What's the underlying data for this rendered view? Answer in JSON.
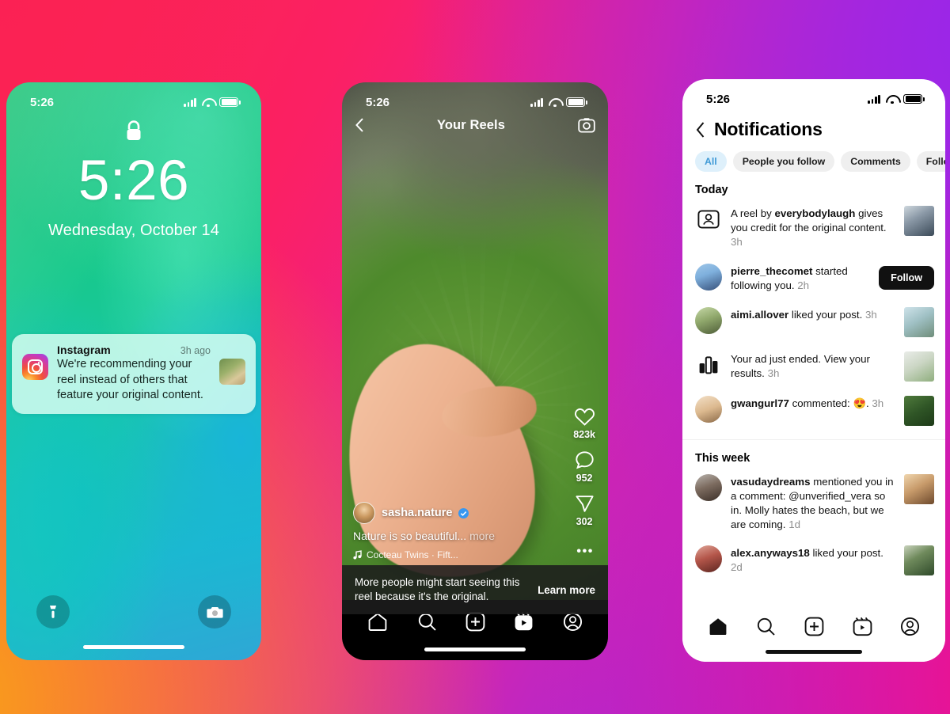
{
  "background": {
    "gradient_colors": [
      "#fb2154",
      "#f9a516",
      "#fb0f80",
      "#9a26e9"
    ]
  },
  "lockscreen": {
    "status": {
      "time": "5:26"
    },
    "time": "5:26",
    "date": "Wednesday, October 14",
    "lock_icon": "lock-icon",
    "notification": {
      "app": "Instagram",
      "time": "3h ago",
      "text": "We're recommending your reel instead of others that feature your original content.",
      "app_icon": "instagram-logo-icon",
      "thumbnail": "notification-thumbnail"
    },
    "flashlight_icon": "flashlight-icon",
    "camera_icon": "camera-icon"
  },
  "reel": {
    "status": {
      "time": "5:26"
    },
    "title": "Your Reels",
    "back_icon": "chevron-left-icon",
    "camera_icon": "camera-icon",
    "actions": {
      "like_count": "823k",
      "comment_count": "952",
      "share_count": "302",
      "more_label": "•••"
    },
    "username": "sasha.nature",
    "verified": true,
    "caption": "Nature is so beautiful...",
    "caption_more": "more",
    "audio": "Cocteau Twins · Fift...",
    "banner": {
      "text": "More people might start seeing this reel because it's the original.",
      "cta": "Learn more"
    },
    "nav": [
      {
        "icon": "home-icon",
        "active": false
      },
      {
        "icon": "search-icon",
        "active": false
      },
      {
        "icon": "create-icon",
        "active": false
      },
      {
        "icon": "reels-icon",
        "active": true
      },
      {
        "icon": "profile-icon",
        "active": false
      }
    ]
  },
  "notifications": {
    "status": {
      "time": "5:26"
    },
    "back_icon": "chevron-left-icon",
    "title": "Notifications",
    "tabs": [
      {
        "label": "All",
        "active": true
      },
      {
        "label": "People you follow",
        "active": false
      },
      {
        "label": "Comments",
        "active": false
      },
      {
        "label": "Follows",
        "active": false
      }
    ],
    "sections": [
      {
        "title": "Today",
        "items": [
          {
            "avatar_icon": "reel-credit-icon",
            "text_prefix": "A reel by ",
            "user": "everybodylaugh",
            "text_suffix": " gives you credit for the original content.",
            "time": "3h",
            "thumb": "post-thumbnail"
          },
          {
            "avatar_icon": "avatar",
            "user": "pierre_thecomet",
            "text_suffix": " started following you.",
            "time": "2h",
            "action": "Follow"
          },
          {
            "avatar_icon": "avatar",
            "user": "aimi.allover",
            "text_suffix": " liked your post.",
            "time": "3h",
            "thumb": "post-thumbnail"
          },
          {
            "avatar_icon": "bar-chart-icon",
            "text_prefix": "Your ad just ended. View your results.",
            "time": "3h",
            "thumb": "post-thumbnail"
          },
          {
            "avatar_icon": "avatar",
            "user": "gwangurl77",
            "text_suffix": " commented: 😍.",
            "time": "3h",
            "thumb": "post-thumbnail"
          }
        ]
      },
      {
        "title": "This week",
        "items": [
          {
            "avatar_icon": "avatar",
            "user": "vasudaydreams",
            "text_suffix": " mentioned you in a comment: @unverified_vera so in. Molly hates the beach, but we are coming.",
            "time": "1d",
            "thumb": "post-thumbnail"
          },
          {
            "avatar_icon": "avatar",
            "user": "alex.anyways18",
            "text_suffix": " liked your post.",
            "time": "2d",
            "thumb": "post-thumbnail"
          }
        ]
      }
    ],
    "nav": [
      {
        "icon": "home-icon",
        "active": true
      },
      {
        "icon": "search-icon",
        "active": false
      },
      {
        "icon": "create-icon",
        "active": false
      },
      {
        "icon": "reels-icon",
        "active": false
      },
      {
        "icon": "profile-icon",
        "active": false
      }
    ]
  }
}
